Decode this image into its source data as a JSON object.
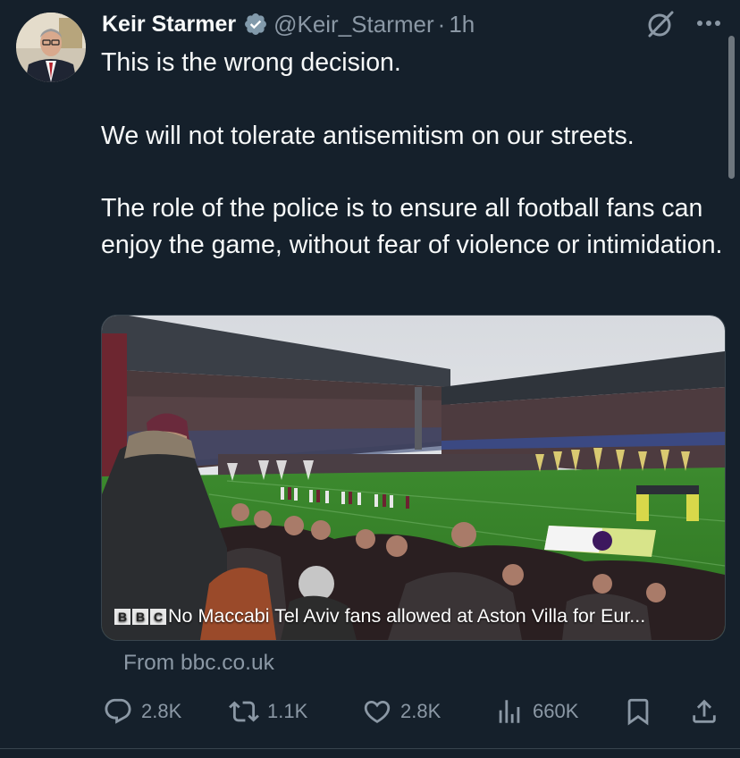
{
  "author": {
    "display_name": "Keir Starmer",
    "handle": "@Keir_Starmer",
    "separator": "·",
    "time": "1h",
    "verified": true
  },
  "tweet": {
    "paragraphs": [
      "This is the wrong decision.",
      "We will not tolerate antisemitism on our streets.",
      "The role of the police is to ensure all football fans can enjoy the game, without fear of violence or intimidation."
    ]
  },
  "card": {
    "image_description": "football-stadium-photo",
    "logo_letters": [
      "B",
      "B",
      "C"
    ],
    "caption": "No Maccabi Tel Aviv fans allowed at Aston Villa for Eur...",
    "source": "From bbc.co.uk"
  },
  "actions": {
    "replies": "2.8K",
    "reposts": "1.1K",
    "likes": "2.8K",
    "views": "660K"
  },
  "icons": {
    "verified": "verified-badge-icon",
    "grok": "grok-icon",
    "more": "more-icon",
    "reply": "reply-icon",
    "repost": "repost-icon",
    "like": "heart-icon",
    "views": "views-icon",
    "bookmark": "bookmark-icon",
    "share": "share-icon"
  },
  "colors": {
    "background": "#15202b",
    "text": "#f7f9f9",
    "muted": "#8b98a5",
    "border": "#38444d"
  }
}
